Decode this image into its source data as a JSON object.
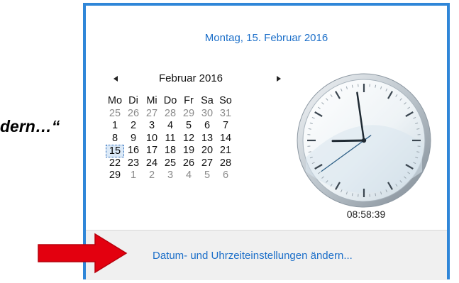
{
  "side_text": "dern…“",
  "popup": {
    "date_heading": "Montag, 15. Februar 2016",
    "calendar": {
      "month_label": "Februar 2016",
      "prev_icon": "triangle-left-icon",
      "next_icon": "triangle-right-icon",
      "weekdays": [
        "Mo",
        "Di",
        "Mi",
        "Do",
        "Fr",
        "Sa",
        "So"
      ],
      "weeks": [
        [
          "25",
          "26",
          "27",
          "28",
          "29",
          "30",
          "31"
        ],
        [
          "1",
          "2",
          "3",
          "4",
          "5",
          "6",
          "7"
        ],
        [
          "8",
          "9",
          "10",
          "11",
          "12",
          "13",
          "14"
        ],
        [
          "15",
          "16",
          "17",
          "18",
          "19",
          "20",
          "21"
        ],
        [
          "22",
          "23",
          "24",
          "25",
          "26",
          "27",
          "28"
        ],
        [
          "29",
          "1",
          "2",
          "3",
          "4",
          "5",
          "6"
        ]
      ],
      "today": "15"
    },
    "clock": {
      "time": "08:58:39",
      "hours": 8,
      "minutes": 58,
      "seconds": 39
    },
    "footer_link": "Datum- und Uhrzeiteinstellungen ändern..."
  },
  "colors": {
    "accent": "#2f86d8",
    "link": "#1c6fc9",
    "arrow": "#e3000f"
  }
}
